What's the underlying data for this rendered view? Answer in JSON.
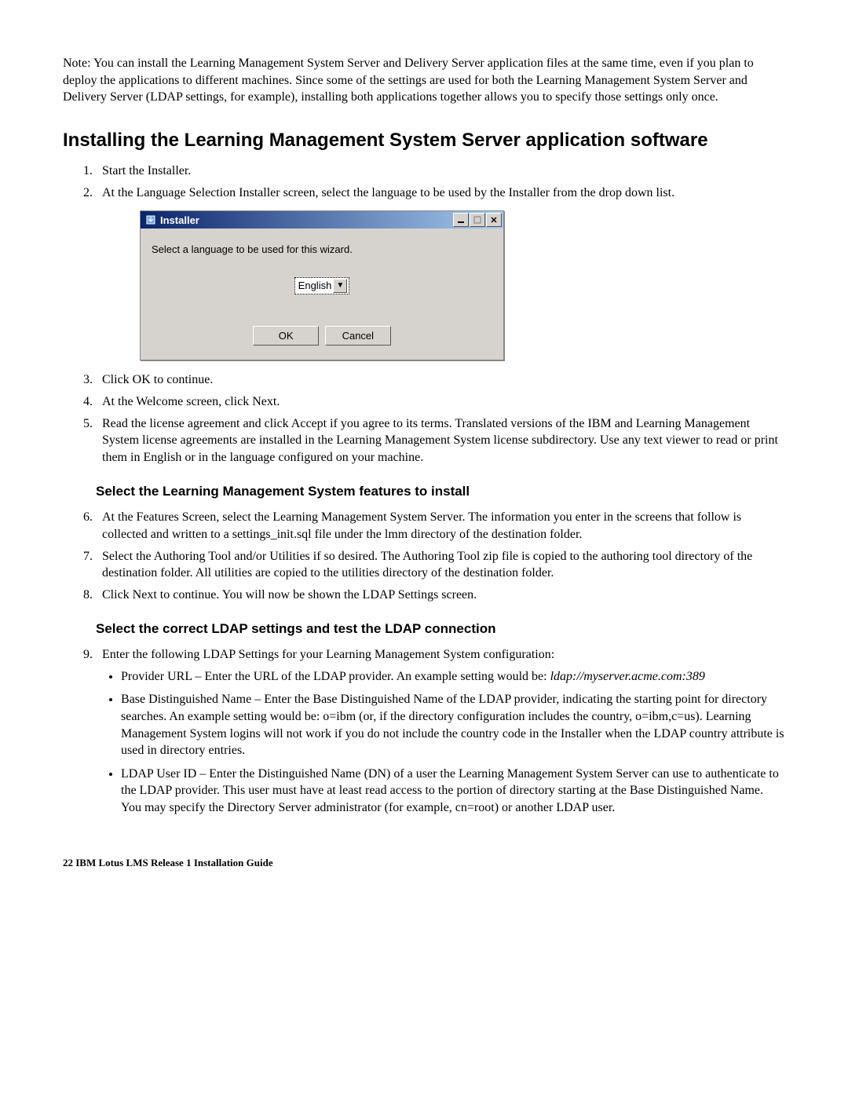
{
  "note": "Note: You can install the Learning Management System Server and Delivery Server application files at the same time, even if you plan to deploy the applications to different machines. Since some of the settings are used for both the Learning Management System Server and Delivery Server (LDAP settings, for example), installing both applications together allows you to specify those settings only once.",
  "h1": "Installing the Learning Management System Server application software",
  "steps1": {
    "s1": "Start the Installer.",
    "s2": "At the Language Selection Installer screen, select the language to be used by the Installer from the drop down list.",
    "s3": "Click OK to continue.",
    "s4": "At the Welcome screen, click Next.",
    "s5": "Read the license agreement and click Accept if you agree to its terms. Translated versions of the IBM and Learning Management System license agreements are installed in the Learning Management System license subdirectory. Use any text viewer to read or print them in English or in the language configured on your machine."
  },
  "sub1": "Select the Learning Management System features to install",
  "steps2": {
    "s6": "At the Features Screen, select the Learning Management System Server. The information you enter in the screens that follow is collected and written to a settings_init.sql file under the lmm directory of the destination folder.",
    "s7": "Select the Authoring Tool and/or Utilities if so desired. The Authoring Tool zip file is copied to the authoring tool directory of the destination folder. All utilities are copied to the utilities directory of the destination folder.",
    "s8": "Click Next to continue. You will now be shown the LDAP Settings screen."
  },
  "sub2": "Select the correct LDAP settings and test the LDAP connection",
  "steps3": {
    "s9": "Enter the following LDAP Settings for your Learning Management System configuration:",
    "b1a": "Provider URL – Enter the URL of the LDAP provider. An example setting would be:",
    "b1b": "ldap://myserver.acme.com:389",
    "b2": "Base Distinguished Name – Enter the Base Distinguished Name of the LDAP provider, indicating the starting point for directory searches. An example setting would be: o=ibm (or, if the directory configuration includes the country, o=ibm,c=us). Learning Management System logins will not work if you do not include the country code in the Installer when the LDAP country attribute is used in directory entries.",
    "b3": "LDAP User ID – Enter the Distinguished Name (DN) of a user the Learning Management System Server can use to authenticate to the LDAP provider. This user must have at least read access to the portion of directory starting at the Base Distinguished Name. You may specify the Directory Server administrator (for example, cn=root) or another LDAP user."
  },
  "installer": {
    "title": "Installer",
    "prompt": "Select a language to be used for this wizard.",
    "language": "English",
    "ok": "OK",
    "cancel": "Cancel"
  },
  "footer": "22 IBM Lotus LMS Release 1 Installation Guide"
}
